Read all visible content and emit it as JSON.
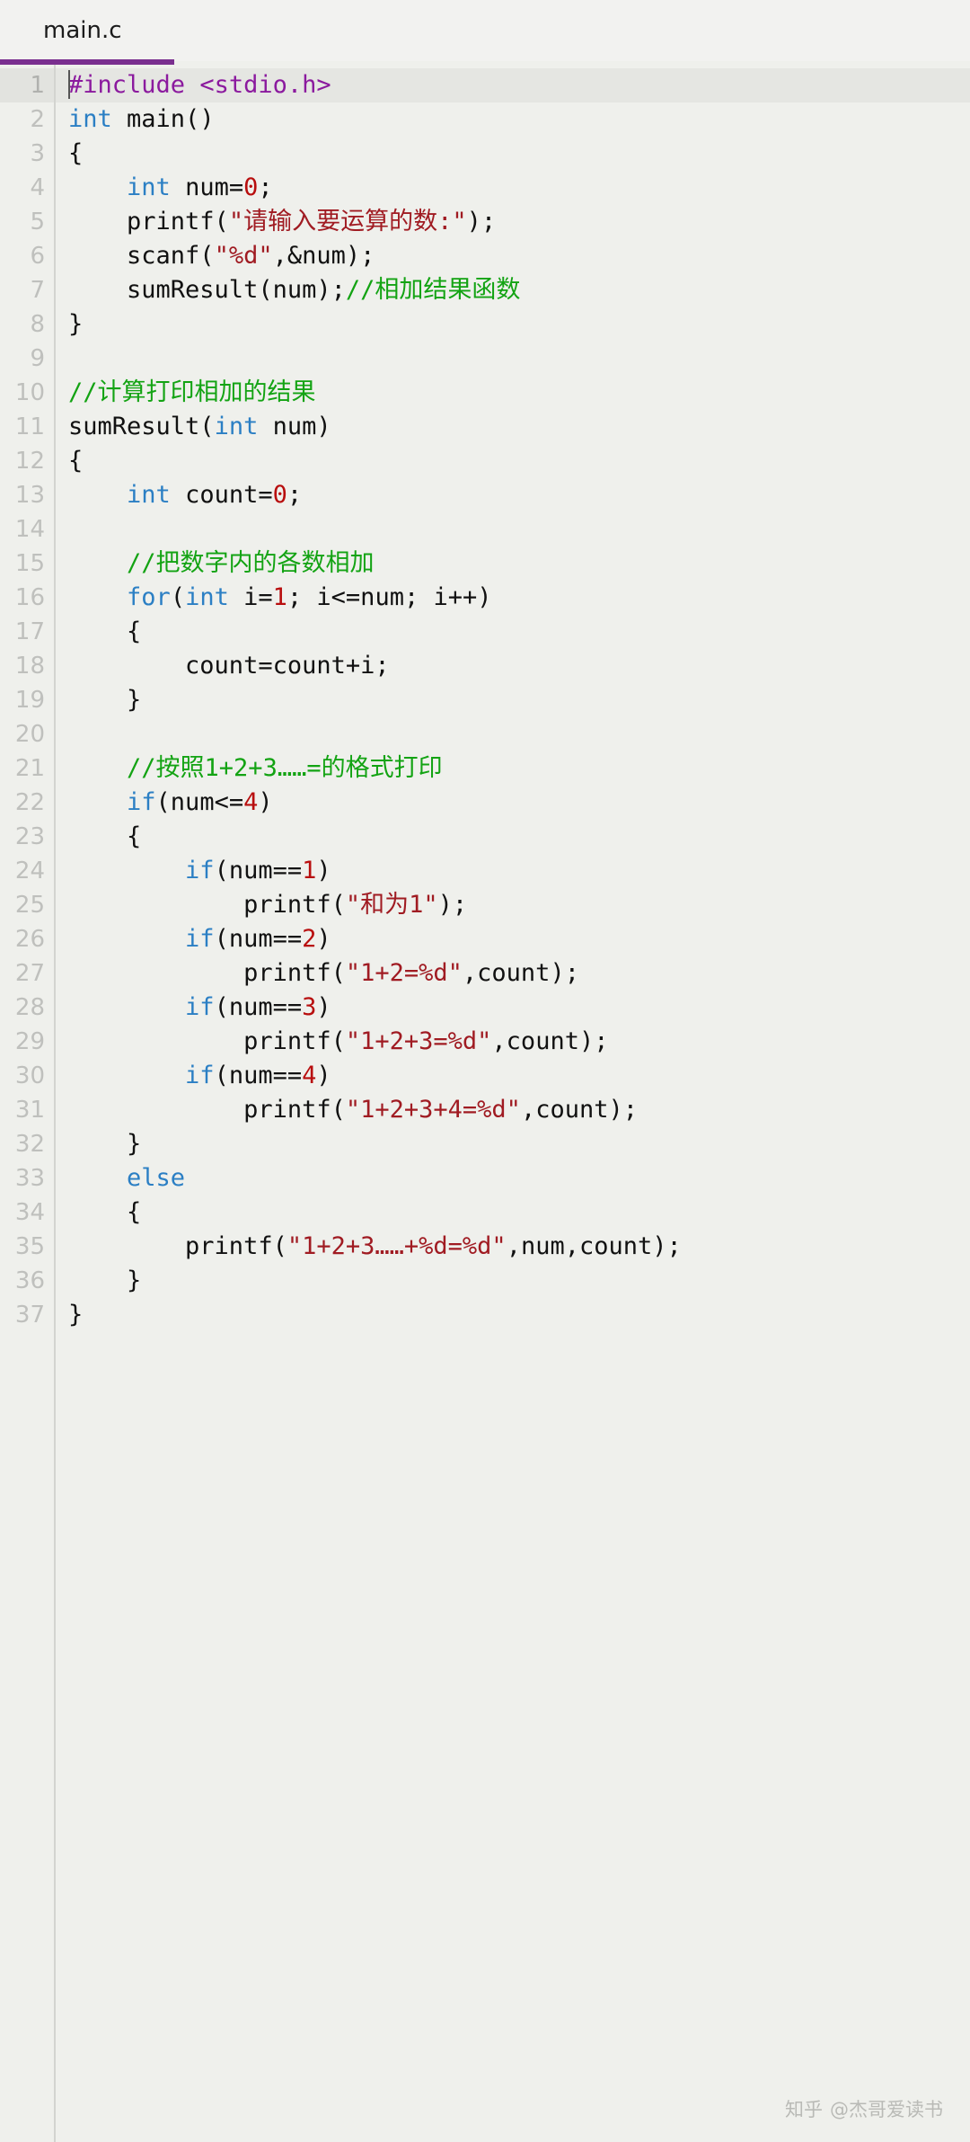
{
  "window": {
    "title": "main.c"
  },
  "tabbar": {
    "tabs": [
      {
        "label": "main.c",
        "active": true
      }
    ]
  },
  "colors": {
    "background": "#eff0ec",
    "tab_bar": "#f2f2f0",
    "active_tab_underline": "#7a2f8f",
    "gutter_text": "#bfc0bd",
    "current_line_highlight": "#e5e6e2",
    "keyword": "#2b7fc4",
    "preprocessor": "#8b1a9e",
    "string": "#a01b22",
    "number": "#b80e0e",
    "comment": "#13a313",
    "plain_text": "#111111",
    "watermark": "#b9bab6"
  },
  "editor": {
    "language": "c",
    "cursor_line": 1,
    "total_lines": 37,
    "line_numbers": [
      1,
      2,
      3,
      4,
      5,
      6,
      7,
      8,
      9,
      10,
      11,
      12,
      13,
      14,
      15,
      16,
      17,
      18,
      19,
      20,
      21,
      22,
      23,
      24,
      25,
      26,
      27,
      28,
      29,
      30,
      31,
      32,
      33,
      34,
      35,
      36,
      37
    ],
    "lines": [
      {
        "n": 1,
        "text": "#include <stdio.h>",
        "tokens": [
          {
            "t": "#include ",
            "c": "pp"
          },
          {
            "t": "<stdio.h>",
            "c": "pp"
          }
        ]
      },
      {
        "n": 2,
        "text": "int main()",
        "tokens": [
          {
            "t": "int",
            "c": "kw"
          },
          {
            "t": " main()",
            "c": "pl"
          }
        ]
      },
      {
        "n": 3,
        "text": "{",
        "tokens": [
          {
            "t": "{",
            "c": "pl"
          }
        ]
      },
      {
        "n": 4,
        "text": "    int num=0;",
        "tokens": [
          {
            "t": "    ",
            "c": "pl"
          },
          {
            "t": "int",
            "c": "kw"
          },
          {
            "t": " num=",
            "c": "pl"
          },
          {
            "t": "0",
            "c": "num"
          },
          {
            "t": ";",
            "c": "pl"
          }
        ]
      },
      {
        "n": 5,
        "text": "    printf(\"请输入要运算的数:\");",
        "tokens": [
          {
            "t": "    printf(",
            "c": "pl"
          },
          {
            "t": "\"请输入要运算的数:\"",
            "c": "str"
          },
          {
            "t": ");",
            "c": "pl"
          }
        ]
      },
      {
        "n": 6,
        "text": "    scanf(\"%d\",&num);",
        "tokens": [
          {
            "t": "    scanf(",
            "c": "pl"
          },
          {
            "t": "\"%d\"",
            "c": "str"
          },
          {
            "t": ",&num);",
            "c": "pl"
          }
        ]
      },
      {
        "n": 7,
        "text": "    sumResult(num);//相加结果函数",
        "tokens": [
          {
            "t": "    sumResult(num);",
            "c": "pl"
          },
          {
            "t": "//相加结果函数",
            "c": "cmt"
          }
        ]
      },
      {
        "n": 8,
        "text": "}",
        "tokens": [
          {
            "t": "}",
            "c": "pl"
          }
        ]
      },
      {
        "n": 9,
        "text": "",
        "tokens": []
      },
      {
        "n": 10,
        "text": "//计算打印相加的结果",
        "tokens": [
          {
            "t": "//计算打印相加的结果",
            "c": "cmt"
          }
        ]
      },
      {
        "n": 11,
        "text": "sumResult(int num)",
        "tokens": [
          {
            "t": "sumResult(",
            "c": "pl"
          },
          {
            "t": "int",
            "c": "kw"
          },
          {
            "t": " num)",
            "c": "pl"
          }
        ]
      },
      {
        "n": 12,
        "text": "{",
        "tokens": [
          {
            "t": "{",
            "c": "pl"
          }
        ]
      },
      {
        "n": 13,
        "text": "    int count=0;",
        "tokens": [
          {
            "t": "    ",
            "c": "pl"
          },
          {
            "t": "int",
            "c": "kw"
          },
          {
            "t": " count=",
            "c": "pl"
          },
          {
            "t": "0",
            "c": "num"
          },
          {
            "t": ";",
            "c": "pl"
          }
        ]
      },
      {
        "n": 14,
        "text": "",
        "tokens": []
      },
      {
        "n": 15,
        "text": "    //把数字内的各数相加",
        "tokens": [
          {
            "t": "    ",
            "c": "pl"
          },
          {
            "t": "//把数字内的各数相加",
            "c": "cmt"
          }
        ]
      },
      {
        "n": 16,
        "text": "    for(int i=1; i<=num; i++)",
        "tokens": [
          {
            "t": "    ",
            "c": "pl"
          },
          {
            "t": "for",
            "c": "kw"
          },
          {
            "t": "(",
            "c": "pl"
          },
          {
            "t": "int",
            "c": "kw"
          },
          {
            "t": " i=",
            "c": "pl"
          },
          {
            "t": "1",
            "c": "num"
          },
          {
            "t": "; i<=num; i++)",
            "c": "pl"
          }
        ]
      },
      {
        "n": 17,
        "text": "    {",
        "tokens": [
          {
            "t": "    {",
            "c": "pl"
          }
        ]
      },
      {
        "n": 18,
        "text": "        count=count+i;",
        "tokens": [
          {
            "t": "        count=count+i;",
            "c": "pl"
          }
        ]
      },
      {
        "n": 19,
        "text": "    }",
        "tokens": [
          {
            "t": "    }",
            "c": "pl"
          }
        ]
      },
      {
        "n": 20,
        "text": "",
        "tokens": []
      },
      {
        "n": 21,
        "text": "    //按照1+2+3……=的格式打印",
        "tokens": [
          {
            "t": "    ",
            "c": "pl"
          },
          {
            "t": "//按照1+2+3……=的格式打印",
            "c": "cmt"
          }
        ]
      },
      {
        "n": 22,
        "text": "    if(num<=4)",
        "tokens": [
          {
            "t": "    ",
            "c": "pl"
          },
          {
            "t": "if",
            "c": "kw"
          },
          {
            "t": "(num<=",
            "c": "pl"
          },
          {
            "t": "4",
            "c": "num"
          },
          {
            "t": ")",
            "c": "pl"
          }
        ]
      },
      {
        "n": 23,
        "text": "    {",
        "tokens": [
          {
            "t": "    {",
            "c": "pl"
          }
        ]
      },
      {
        "n": 24,
        "text": "        if(num==1)",
        "tokens": [
          {
            "t": "        ",
            "c": "pl"
          },
          {
            "t": "if",
            "c": "kw"
          },
          {
            "t": "(num==",
            "c": "pl"
          },
          {
            "t": "1",
            "c": "num"
          },
          {
            "t": ")",
            "c": "pl"
          }
        ]
      },
      {
        "n": 25,
        "text": "            printf(\"和为1\");",
        "tokens": [
          {
            "t": "            printf(",
            "c": "pl"
          },
          {
            "t": "\"和为1\"",
            "c": "str"
          },
          {
            "t": ");",
            "c": "pl"
          }
        ]
      },
      {
        "n": 26,
        "text": "        if(num==2)",
        "tokens": [
          {
            "t": "        ",
            "c": "pl"
          },
          {
            "t": "if",
            "c": "kw"
          },
          {
            "t": "(num==",
            "c": "pl"
          },
          {
            "t": "2",
            "c": "num"
          },
          {
            "t": ")",
            "c": "pl"
          }
        ]
      },
      {
        "n": 27,
        "text": "            printf(\"1+2=%d\",count);",
        "tokens": [
          {
            "t": "            printf(",
            "c": "pl"
          },
          {
            "t": "\"1+2=%d\"",
            "c": "str"
          },
          {
            "t": ",count);",
            "c": "pl"
          }
        ]
      },
      {
        "n": 28,
        "text": "        if(num==3)",
        "tokens": [
          {
            "t": "        ",
            "c": "pl"
          },
          {
            "t": "if",
            "c": "kw"
          },
          {
            "t": "(num==",
            "c": "pl"
          },
          {
            "t": "3",
            "c": "num"
          },
          {
            "t": ")",
            "c": "pl"
          }
        ]
      },
      {
        "n": 29,
        "text": "            printf(\"1+2+3=%d\",count);",
        "tokens": [
          {
            "t": "            printf(",
            "c": "pl"
          },
          {
            "t": "\"1+2+3=%d\"",
            "c": "str"
          },
          {
            "t": ",count);",
            "c": "pl"
          }
        ]
      },
      {
        "n": 30,
        "text": "        if(num==4)",
        "tokens": [
          {
            "t": "        ",
            "c": "pl"
          },
          {
            "t": "if",
            "c": "kw"
          },
          {
            "t": "(num==",
            "c": "pl"
          },
          {
            "t": "4",
            "c": "num"
          },
          {
            "t": ")",
            "c": "pl"
          }
        ]
      },
      {
        "n": 31,
        "text": "            printf(\"1+2+3+4=%d\",count);",
        "tokens": [
          {
            "t": "            printf(",
            "c": "pl"
          },
          {
            "t": "\"1+2+3+4=%d\"",
            "c": "str"
          },
          {
            "t": ",count);",
            "c": "pl"
          }
        ]
      },
      {
        "n": 32,
        "text": "    }",
        "tokens": [
          {
            "t": "    }",
            "c": "pl"
          }
        ]
      },
      {
        "n": 33,
        "text": "    else",
        "tokens": [
          {
            "t": "    ",
            "c": "pl"
          },
          {
            "t": "else",
            "c": "kw"
          }
        ]
      },
      {
        "n": 34,
        "text": "    {",
        "tokens": [
          {
            "t": "    {",
            "c": "pl"
          }
        ]
      },
      {
        "n": 35,
        "text": "        printf(\"1+2+3……+%d=%d\",num,count);",
        "tokens": [
          {
            "t": "        printf(",
            "c": "pl"
          },
          {
            "t": "\"1+2+3……+%d=%d\"",
            "c": "str"
          },
          {
            "t": ",num,count);",
            "c": "pl"
          }
        ]
      },
      {
        "n": 36,
        "text": "    }",
        "tokens": [
          {
            "t": "    }",
            "c": "pl"
          }
        ]
      },
      {
        "n": 37,
        "text": "}",
        "tokens": [
          {
            "t": "}",
            "c": "pl"
          }
        ]
      }
    ]
  },
  "watermark": {
    "site": "知乎",
    "author": "@杰哥爱读书"
  }
}
